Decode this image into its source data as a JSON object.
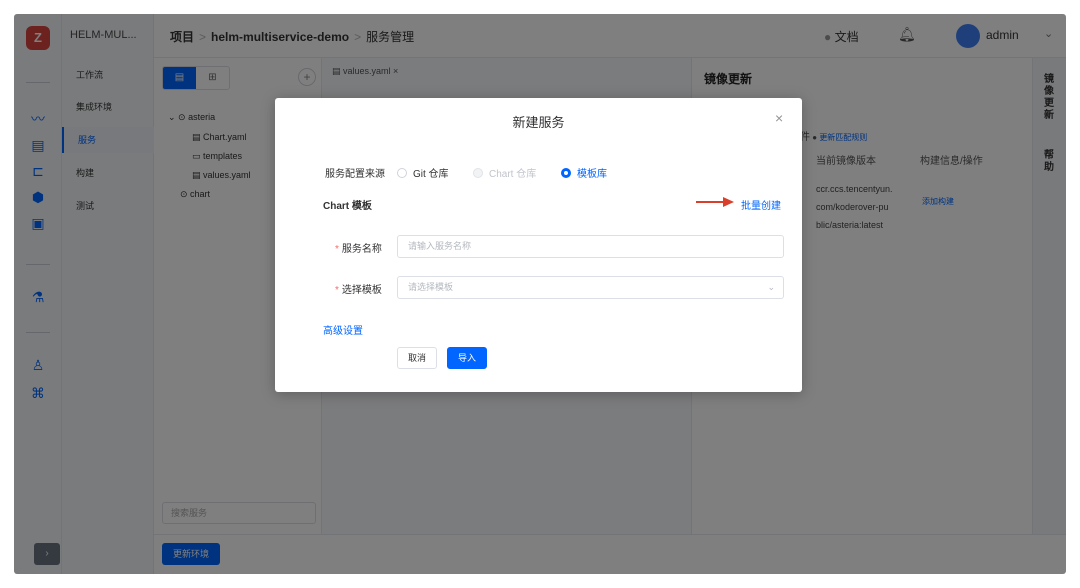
{
  "nav": {
    "project_short": "HELM-MUL...",
    "items": [
      "工作流",
      "集成环境",
      "服务",
      "构建",
      "测试"
    ]
  },
  "header": {
    "crumb_root": "项目",
    "crumb_project": "helm-multiservice-demo",
    "crumb_page": "服务管理",
    "docs": "文档",
    "user": "admin"
  },
  "service_tree": {
    "root": "asteria",
    "children": [
      "Chart.yaml",
      "templates",
      "values.yaml"
    ],
    "second_root": "chart",
    "search_placeholder": "搜索服务"
  },
  "editor": {
    "tab": "values.yaml"
  },
  "image_panel": {
    "title": "镜像更新",
    "rule_link_prefix": "件",
    "rule_link": "更新匹配规则",
    "col_current": "当前镜像版本",
    "col_build": "构建信息/操作",
    "image_lines": [
      "ccr.ccs.tencentyun.",
      "com/koderover-pu",
      "blic/asteria:latest"
    ],
    "add_build": "添加构建"
  },
  "side_tabs": [
    "镜像更新",
    "帮助"
  ],
  "bottom": {
    "update_env": "更新环境"
  },
  "dialog": {
    "title": "新建服务",
    "source_label": "服务配置来源",
    "source_options": [
      "Git 仓库",
      "Chart 仓库",
      "模板库"
    ],
    "selected_source": "模板库",
    "chart_template_heading": "Chart 模板",
    "batch_create": "批量创建",
    "service_name_label": "服务名称",
    "service_name_placeholder": "请输入服务名称",
    "select_template_label": "选择模板",
    "select_template_placeholder": "请选择模板",
    "advanced": "高级设置",
    "cancel": "取消",
    "import": "导入",
    "accent_color": "#0066ff",
    "arrow_color": "#d9402c"
  }
}
